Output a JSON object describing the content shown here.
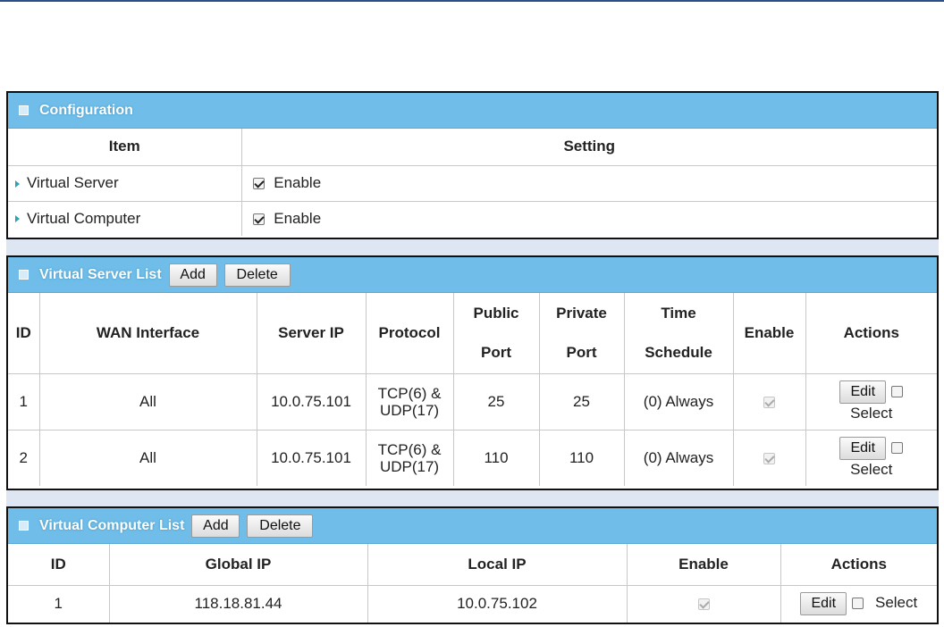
{
  "configuration": {
    "title": "Configuration",
    "columns": [
      "Item",
      "Setting"
    ],
    "rows": [
      {
        "item": "Virtual Server",
        "enabled": true,
        "label": "Enable"
      },
      {
        "item": "Virtual Computer",
        "enabled": true,
        "label": "Enable"
      }
    ]
  },
  "server_list": {
    "title": "Virtual Server List",
    "add_label": "Add",
    "delete_label": "Delete",
    "columns": {
      "id": "ID",
      "wan": "WAN Interface",
      "server_ip": "Server IP",
      "protocol": "Protocol",
      "public_port_1": "Public",
      "public_port_2": "Port",
      "private_port_1": "Private",
      "private_port_2": "Port",
      "time_1": "Time",
      "time_2": "Schedule",
      "enable": "Enable",
      "actions": "Actions"
    },
    "rows": [
      {
        "id": "1",
        "wan": "All",
        "server_ip": "10.0.75.101",
        "protocol_1": "TCP(6) &",
        "protocol_2": "UDP(17)",
        "public_port": "25",
        "private_port": "25",
        "schedule": "(0) Always",
        "edit": "Edit",
        "select": "Select"
      },
      {
        "id": "2",
        "wan": "All",
        "server_ip": "10.0.75.101",
        "protocol_1": "TCP(6) &",
        "protocol_2": "UDP(17)",
        "public_port": "110",
        "private_port": "110",
        "schedule": "(0) Always",
        "edit": "Edit",
        "select": "Select"
      }
    ]
  },
  "computer_list": {
    "title": "Virtual Computer List",
    "add_label": "Add",
    "delete_label": "Delete",
    "columns": {
      "id": "ID",
      "global_ip": "Global IP",
      "local_ip": "Local IP",
      "enable": "Enable",
      "actions": "Actions"
    },
    "rows": [
      {
        "id": "1",
        "global_ip": "118.18.81.44",
        "local_ip": "10.0.75.102",
        "edit": "Edit",
        "select": "Select"
      }
    ]
  },
  "colors": {
    "header_bar": "#6fbde8",
    "panel_gap": "#dde6f2",
    "arrow": "#2aa4b0"
  }
}
